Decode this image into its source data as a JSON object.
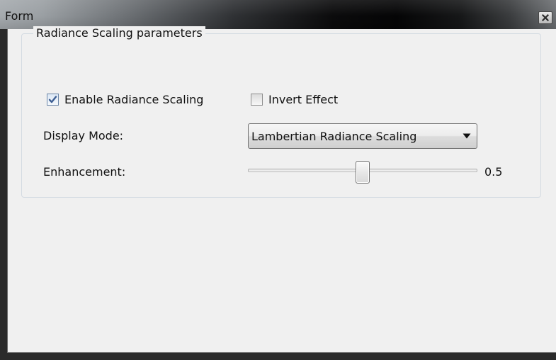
{
  "window": {
    "title": "Form"
  },
  "group": {
    "title": "Radiance Scaling parameters"
  },
  "enable_radiance_scaling": {
    "label": "Enable Radiance Scaling",
    "checked": true
  },
  "invert_effect": {
    "label": "Invert Effect",
    "checked": false
  },
  "display_mode": {
    "label": "Display Mode:",
    "selected": "Lambertian Radiance Scaling"
  },
  "enhancement": {
    "label": "Enhancement:",
    "value": "0.5",
    "fraction": 0.5
  },
  "icons": {
    "close": "close-icon",
    "check": "check-icon",
    "dropdown": "chevron-down-icon"
  }
}
